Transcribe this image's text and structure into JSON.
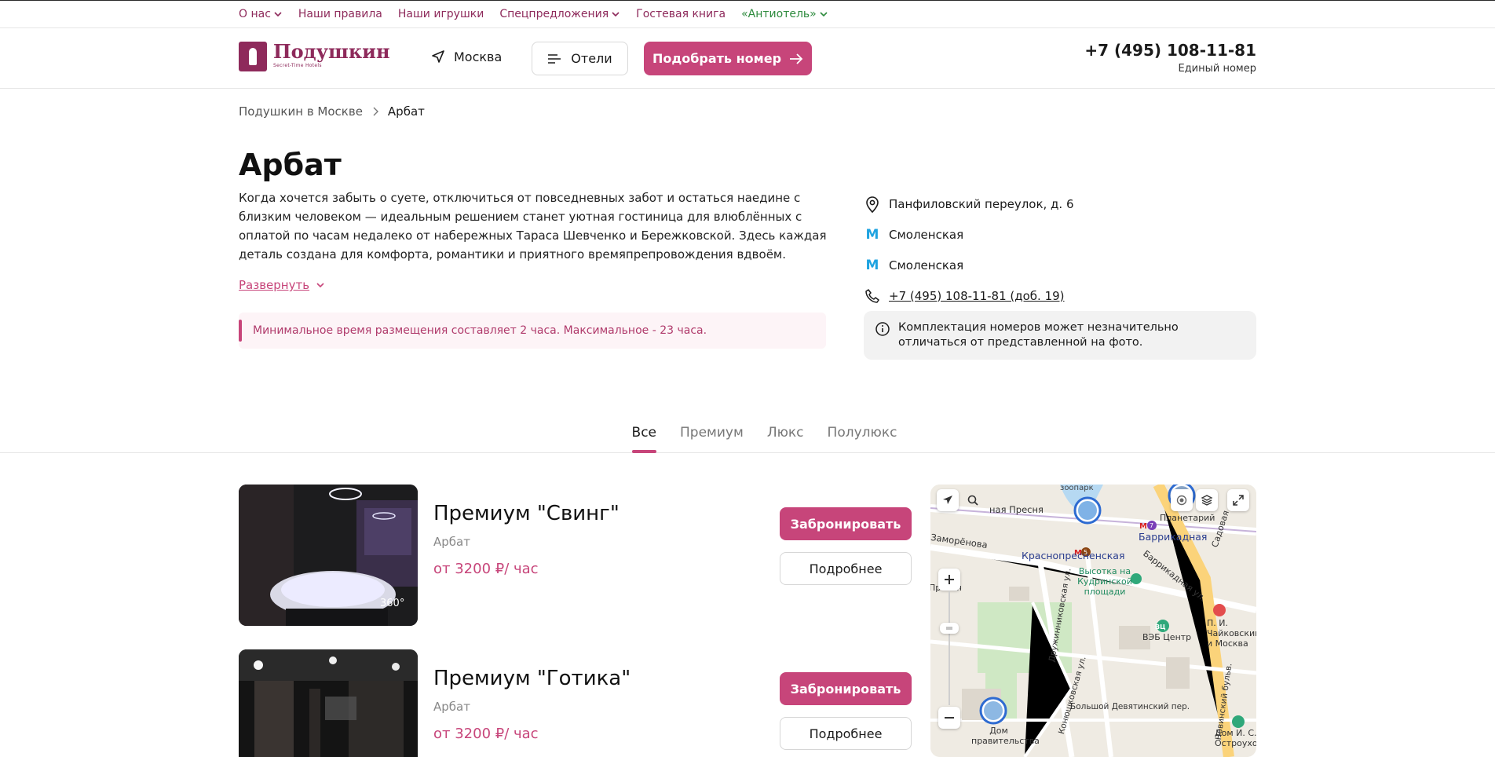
{
  "topnav": {
    "items": [
      {
        "label": "О нас",
        "dropdown": true
      },
      {
        "label": "Наши правила",
        "dropdown": false
      },
      {
        "label": "Наши игрушки",
        "dropdown": false
      },
      {
        "label": "Спецпредложения",
        "dropdown": true
      },
      {
        "label": "Гостевая книга",
        "dropdown": false
      },
      {
        "label": "«Антиотель»",
        "dropdown": true
      }
    ]
  },
  "header": {
    "logo_text": "Подушкин",
    "logo_sub": "Secret-Time Hotels",
    "city": "Москва",
    "hotels_label": "Отели",
    "pick_label": "Подобрать номер",
    "phone": "+7 (495) 108-11-81",
    "phone_note": "Единый номер"
  },
  "breadcrumb": {
    "parent": "Подушкин в Москве",
    "current": "Арбат"
  },
  "hotel": {
    "title": "Арбат",
    "description": "Когда хочется забыть о суете, отключиться от повседневных забот и остаться наедине с близким человеком — идеальным решением станет уютная гостиница для влюблённых с оплатой по часам недалеко от набережных Тараса Шевченко и Бережковской. Здесь каждая деталь создана для комфорта, романтики и приятного времяпрепровождения вдвоём.",
    "expand_label": "Развернуть",
    "notice": "Минимальное время размещения составляет 2 часа. Максимальное - 23 часа.",
    "address": "Панфиловский переулок, д. 6",
    "metro": [
      "Смоленская",
      "Смоленская"
    ],
    "phone": "+7 (495) 108-11-81 (доб. 19)",
    "photo_note": "Комплектация номеров может незначительно отличаться от представленной на фото."
  },
  "tabs": [
    "Все",
    "Премиум",
    "Люкс",
    "Полулюкс"
  ],
  "rooms": [
    {
      "title": "Премиум \"Свинг\"",
      "location": "Арбат",
      "price": "от 3200 ₽/ час",
      "book": "Забронировать",
      "more": "Подробнее",
      "badge": "360°"
    },
    {
      "title": "Премиум \"Готика\"",
      "location": "Арбат",
      "price": "от 3200 ₽/ час",
      "book": "Забронировать",
      "more": "Подробнее"
    }
  ],
  "map": {
    "labels": {
      "zoo": "зоопарк",
      "presnya": "ная Пресня",
      "planetarium": "Планетарий",
      "zamorenova": "Заморёнова",
      "barrikadnaya": "Баррикадная",
      "krasnopresnenskaya": "Краснопресненская",
      "vysotka": "Высотка на Кудринской площади",
      "barrikadnaya_ul": "Баррикадная ул.",
      "sadovaya": "Садовая",
      "druzhinnikovskaya": "Дружинниковская ул.",
      "veb": "ВЭБ Центр",
      "tchaikovsky": "П. И. Чайковский и Москва",
      "presnya2": "Пресня",
      "konyushkovskaya": "Конюшковская ул.",
      "devyatinsky": "Большой Девятинский пер.",
      "novinsky": "Новинский бульв.",
      "dom_prav": "Дом правительства",
      "dom_ostrou": "Дом И. С. Остроухов",
      "metro5": "5",
      "metro7": "7",
      "badge_veb": "ВЦ"
    }
  }
}
